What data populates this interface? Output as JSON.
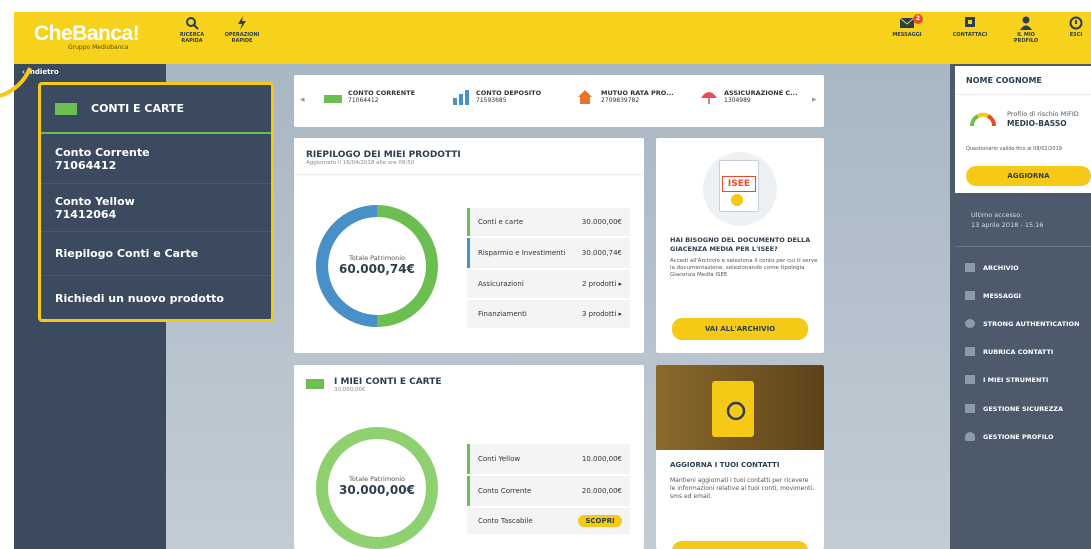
{
  "app": {
    "name": "CheBanca!",
    "tagline": "Gruppo Mediobanca"
  },
  "topbar": {
    "left_actions": [
      {
        "label1": "RICERCA",
        "label2": "RAPIDA"
      },
      {
        "label1": "OPERAZIONI",
        "label2": "RAPIDE"
      }
    ],
    "messages": {
      "label": "MESSAGGI",
      "count": "2"
    },
    "contact": {
      "label": "CONTATTACI"
    },
    "profile": {
      "label1": "IL MIO",
      "label2": "PROFILO"
    },
    "exit": {
      "label": "ESCI"
    }
  },
  "sidebar": {
    "back": "‹ Indietro"
  },
  "menu": {
    "title": "CONTI E CARTE",
    "items": [
      {
        "label": "Conto Corrente",
        "number": "71064412"
      },
      {
        "label": "Conto Yellow",
        "number": "71412064"
      },
      {
        "label": "Riepilogo Conti e Carte"
      },
      {
        "label": "Richiedi un nuovo prodotto"
      }
    ]
  },
  "tabs": [
    {
      "title": "CONTO CORRENTE",
      "number": "71064412"
    },
    {
      "title": "CONTO DEPOSITO",
      "number": "71593685"
    },
    {
      "title": "MUTUO RATA PRO...",
      "number": "2709839782"
    },
    {
      "title": "ASSICURAZIONE C...",
      "number": "1304989"
    }
  ],
  "summary": {
    "title": "RIEPILOGO DEI MIEI PRODOTTI",
    "updated": "Aggiornato il 16/04/2018 alle ore 09:50",
    "donut_label": "Totale Patrimonio",
    "donut_value": "60.000,74€",
    "rows": [
      {
        "label": "Conti e carte",
        "value": "30.000,00€"
      },
      {
        "label": "Risparmio e Investimenti",
        "value": "30.000,74€"
      },
      {
        "label": "Assicurazioni",
        "value": "2 prodotti ▸"
      },
      {
        "label": "Finanziamenti",
        "value": "3 prodotti ▸"
      }
    ]
  },
  "accounts": {
    "title": "I MIEI CONTI E CARTE",
    "amount": "30.000,00€",
    "donut_label": "Totale Patrimonio",
    "donut_value": "30.000,00€",
    "rows": [
      {
        "label": "Conti Yellow",
        "value": "10.000,00€"
      },
      {
        "label": "Conto Corrente",
        "value": "20.000,00€"
      },
      {
        "label": "Conto Tascabile",
        "value": "SCOPRI"
      }
    ]
  },
  "isee": {
    "badge": "ISEE",
    "title": "HAI BISOGNO DEL DOCUMENTO DELLA GIACENZA MEDIA PER L'ISEE?",
    "body": "Accedi all'Archivio e seleziona il conto per cui ti serve la documentazione, selezionando come tipologia Giacenza Media ISEE",
    "button": "VAI ALL'ARCHIVIO"
  },
  "contacts": {
    "title": "AGGIORNA I TUOI CONTATTI",
    "body": "Mantieni aggiornati i tuoi contatti per ricevere le informazioni relative ai tuoi conti, movimenti, sms ed email."
  },
  "profile": {
    "name": "NOME COGNOME",
    "risk_label": "Profilo di rischio MiFID",
    "risk_value": "MEDIO-BASSO",
    "validity": "Questionario valido fino al 08/02/2019",
    "update_button": "AGGIORNA",
    "last_access_label": "Ultimo accesso:",
    "last_access_value": "13 aprile 2018 - 15.16"
  },
  "sidemenu": [
    "ARCHIVIO",
    "MESSAGGI",
    "STRONG AUTHENTICATION",
    "RUBRICA CONTATTI",
    "I MIEI STRUMENTI",
    "GESTIONE SICUREZZA",
    "GESTIONE PROFILO"
  ],
  "colors": {
    "brand": "#f7d21c",
    "navy": "#3b4a5e",
    "green": "#6dbe50",
    "blue": "#4a90c8"
  }
}
